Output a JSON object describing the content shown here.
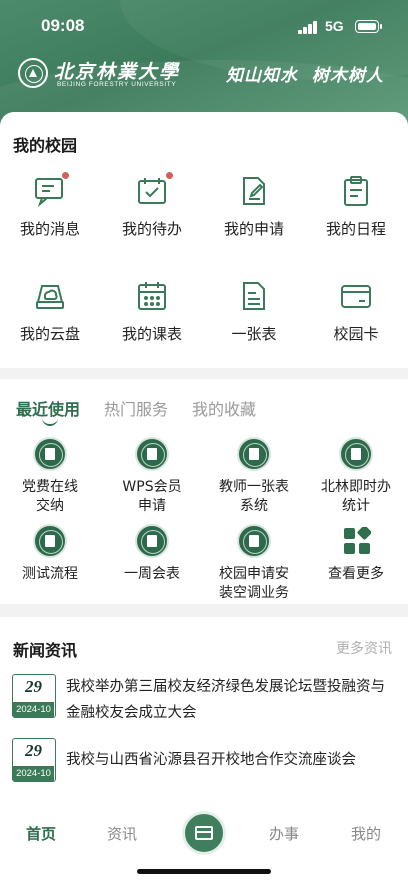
{
  "status_bar": {
    "time": "09:08",
    "network": "5G",
    "icons": [
      "signal-icon",
      "battery-icon"
    ]
  },
  "header": {
    "university_name_cn": "北京林業大學",
    "university_name_en": "BEIJING FORESTRY UNIVERSITY",
    "motto": "知山知水  树木树人",
    "colors": {
      "primary": "#3b7a5a",
      "accent": "#2f6e4e"
    }
  },
  "my_campus": {
    "title": "我的校园",
    "items": [
      {
        "label": "我的消息",
        "icon": "message-icon",
        "has_dot": true
      },
      {
        "label": "我的待办",
        "icon": "todo-calendar-icon",
        "has_dot": true
      },
      {
        "label": "我的申请",
        "icon": "application-edit-icon",
        "has_dot": false
      },
      {
        "label": "我的日程",
        "icon": "schedule-clipboard-icon",
        "has_dot": false
      },
      {
        "label": "我的云盘",
        "icon": "cloud-drive-icon",
        "has_dot": false
      },
      {
        "label": "我的课表",
        "icon": "course-calendar-icon",
        "has_dot": false
      },
      {
        "label": "一张表",
        "icon": "form-document-icon",
        "has_dot": false
      },
      {
        "label": "校园卡",
        "icon": "campus-card-icon",
        "has_dot": false
      }
    ]
  },
  "recent": {
    "tabs": [
      {
        "label": "最近使用",
        "active": true
      },
      {
        "label": "热门服务",
        "active": false
      },
      {
        "label": "我的收藏",
        "active": false
      }
    ],
    "services": [
      {
        "label": "党费在线\n交纳",
        "icon": "university-seal-icon"
      },
      {
        "label": "WPS会员\n申请",
        "icon": "university-seal-icon"
      },
      {
        "label": "教师一张表\n系统",
        "icon": "university-seal-icon"
      },
      {
        "label": "北林即时办\n统计",
        "icon": "university-seal-icon"
      },
      {
        "label": "测试流程",
        "icon": "university-seal-icon"
      },
      {
        "label": "一周会表",
        "icon": "university-seal-icon"
      },
      {
        "label": "校园申请安\n装空调业务",
        "icon": "university-seal-icon"
      },
      {
        "label": "查看更多",
        "icon": "grid-more-icon"
      }
    ]
  },
  "news": {
    "title": "新闻资讯",
    "more_label": "更多资讯",
    "items": [
      {
        "day": "29",
        "year_month": "2024-10",
        "text": "我校举办第三届校友经济绿色发展论坛暨投融资与金融校友会成立大会"
      },
      {
        "day": "29",
        "year_month": "2024-10",
        "text": "我校与山西省沁源县召开校地合作交流座谈会"
      }
    ]
  },
  "bottom_nav": {
    "items": [
      {
        "label": "首页",
        "active": true
      },
      {
        "label": "资讯",
        "active": false
      },
      {
        "label": "办事",
        "active": false
      },
      {
        "label": "我的",
        "active": false
      }
    ],
    "center_icon": "card-scan-icon"
  }
}
